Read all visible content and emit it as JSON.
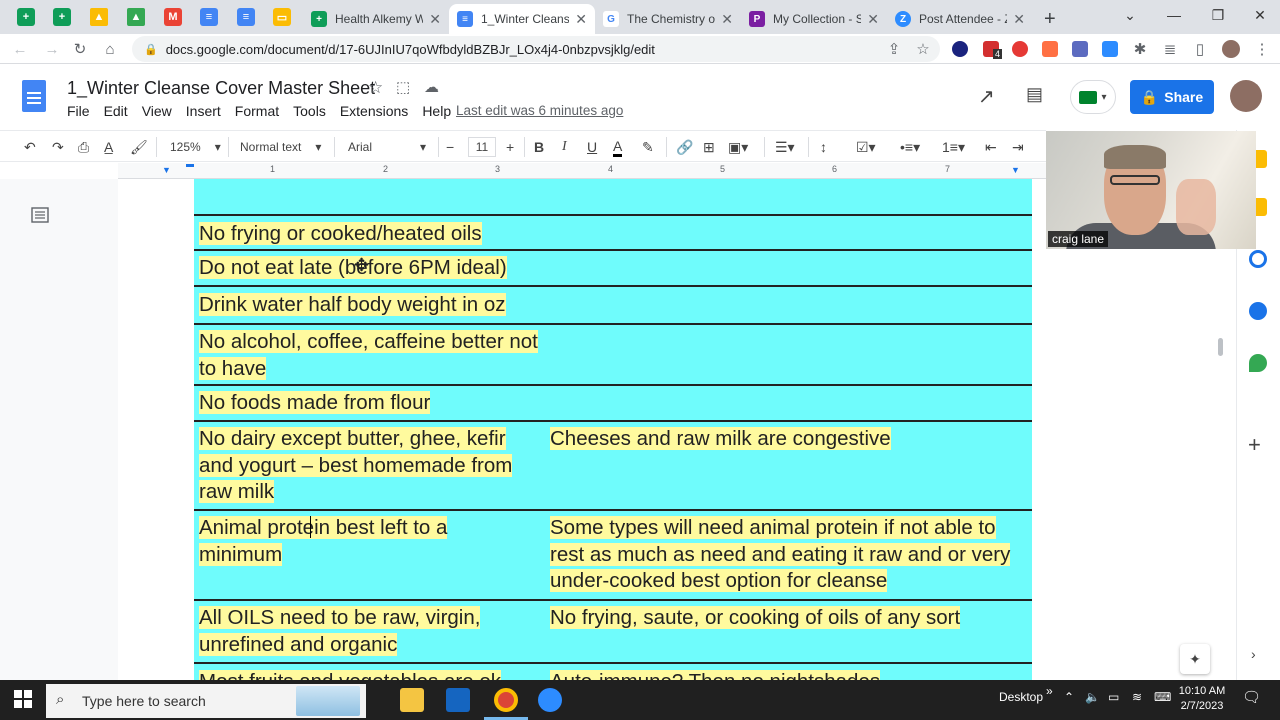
{
  "browser": {
    "tabs": [
      {
        "label": "Health Alkemy W",
        "color": "#0f9d58"
      },
      {
        "label": "1_Winter Cleanse",
        "color": "#4285f4"
      },
      {
        "label": "The Chemistry of",
        "color": "#4285f4"
      },
      {
        "label": "My Collection - S",
        "color": "#7b1fa2"
      },
      {
        "label": "Post Attendee - Z",
        "color": "#2d8cff"
      }
    ],
    "url": "docs.google.com/document/d/17-6UJInIU7qoWfbdyldBZBJr_LOx4j4-0nbzpvsjklg/edit",
    "ext_badge": "4"
  },
  "docs": {
    "title": "1_Winter Cleanse Cover Master Sheet",
    "menu": [
      "File",
      "Edit",
      "View",
      "Insert",
      "Format",
      "Tools",
      "Extensions",
      "Help"
    ],
    "last_edit": "Last edit was 6 minutes ago",
    "share_label": "Share",
    "zoom": "125%",
    "style": "Normal text",
    "font": "Arial",
    "font_size": "11",
    "ruler_numbers": [
      "1",
      "2",
      "3",
      "4",
      "5",
      "6",
      "7"
    ]
  },
  "table_rows": [
    {
      "left": "",
      "right": ""
    },
    {
      "left": "No frying or cooked/heated oils",
      "right": ""
    },
    {
      "left": "Do not eat late (before 6PM ideal)",
      "right": ""
    },
    {
      "left": "Drink water half body weight in oz",
      "right": ""
    },
    {
      "left": "No alcohol, coffee, caffeine better not to have",
      "right": ""
    },
    {
      "left": "No foods made from flour",
      "right": ""
    },
    {
      "left": "No dairy except butter, ghee, kefir and yogurt – best homemade from raw milk",
      "right": "Cheeses and raw milk are congestive"
    },
    {
      "left": "Animal protein best left to a minimum",
      "right": "Some types will need animal protein if not able to rest as much as need and eating it raw and or very under-cooked best option for cleanse"
    },
    {
      "left": "All OILS need to be raw, virgin, unrefined and organic",
      "right": "No frying, saute, or cooking of oils of any sort"
    },
    {
      "left": "Most fruits and vegetables are ok",
      "right": "Auto-immune? Then no nightshades"
    }
  ],
  "video": {
    "name": "craig lane"
  },
  "taskbar": {
    "search_placeholder": "Type here to search",
    "desktop_label": "Desktop",
    "time": "10:10 AM",
    "date": "2/7/2023"
  }
}
